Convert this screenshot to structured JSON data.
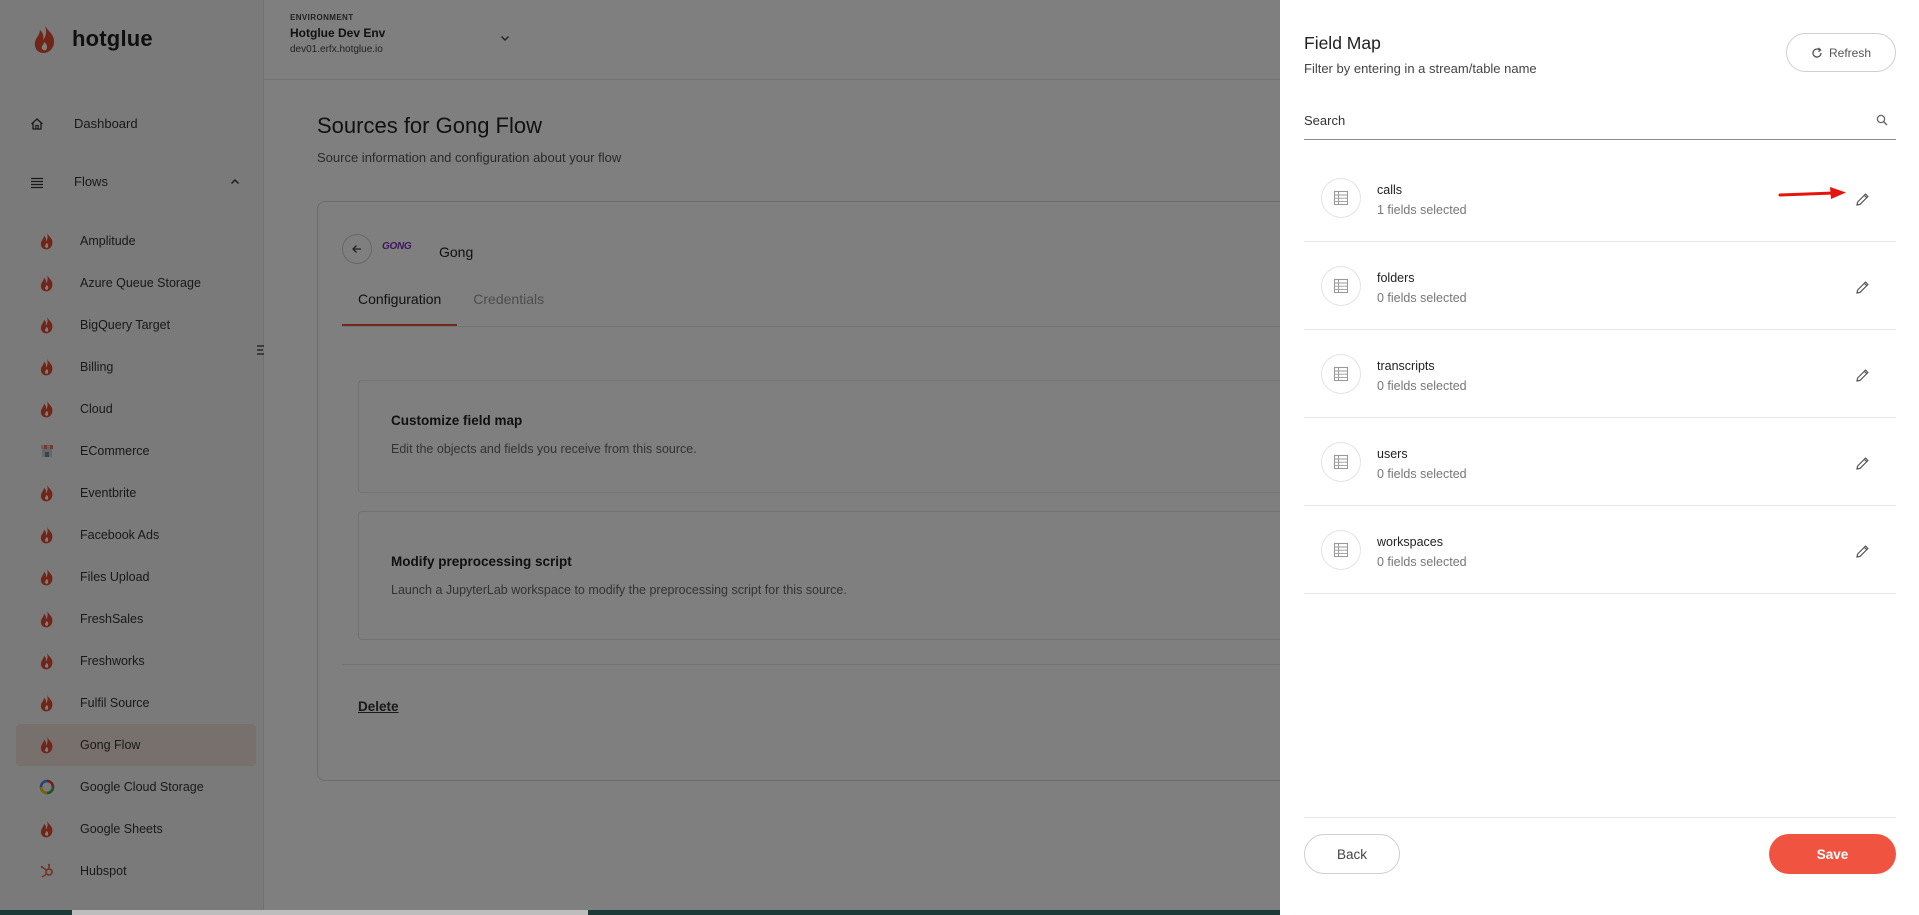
{
  "brand": {
    "name": "hotglue",
    "accent": "#f05440"
  },
  "environment": {
    "caption": "ENVIRONMENT",
    "name": "Hotglue Dev Env",
    "host": "dev01.erfx.hotglue.io"
  },
  "sidebar": {
    "dashboard_label": "Dashboard",
    "flows_label": "Flows",
    "flows": [
      {
        "label": "Amplitude",
        "icon": "hotglue-flame-icon"
      },
      {
        "label": "Azure Queue Storage",
        "icon": "hotglue-flame-icon"
      },
      {
        "label": "BigQuery Target",
        "icon": "hotglue-flame-icon"
      },
      {
        "label": "Billing",
        "icon": "hotglue-flame-icon"
      },
      {
        "label": "Cloud",
        "icon": "hotglue-flame-icon"
      },
      {
        "label": "ECommerce",
        "icon": "store-icon"
      },
      {
        "label": "Eventbrite",
        "icon": "hotglue-flame-icon"
      },
      {
        "label": "Facebook Ads",
        "icon": "hotglue-flame-icon"
      },
      {
        "label": "Files Upload",
        "icon": "hotglue-flame-icon"
      },
      {
        "label": "FreshSales",
        "icon": "hotglue-flame-icon"
      },
      {
        "label": "Freshworks",
        "icon": "hotglue-flame-icon"
      },
      {
        "label": "Fulfil Source",
        "icon": "hotglue-flame-icon"
      },
      {
        "label": "Gong Flow",
        "icon": "hotglue-flame-icon",
        "active": true
      },
      {
        "label": "Google Cloud Storage",
        "icon": "google-cloud-icon"
      },
      {
        "label": "Google Sheets",
        "icon": "hotglue-flame-icon"
      },
      {
        "label": "Hubspot",
        "icon": "hubspot-icon"
      }
    ]
  },
  "main": {
    "title": "Sources for Gong Flow",
    "subtitle": "Source information and configuration about your flow",
    "source_logo_text": "GONG",
    "source_name": "Gong",
    "tabs": [
      {
        "label": "Configuration",
        "active": true
      },
      {
        "label": "Credentials",
        "active": false
      }
    ],
    "sections": [
      {
        "title": "Customize field map",
        "description": "Edit the objects and fields you receive from this source."
      },
      {
        "title": "Modify preprocessing script",
        "description": "Launch a JupyterLab workspace to modify the preprocessing script for this source."
      }
    ],
    "delete_label": "Delete"
  },
  "drawer": {
    "title": "Field Map",
    "subtitle": "Filter by entering in a stream/table name",
    "refresh_label": "Refresh",
    "search_placeholder": "Search",
    "streams": [
      {
        "name": "calls",
        "count": "1 fields selected",
        "annotated": true
      },
      {
        "name": "folders",
        "count": "0 fields selected"
      },
      {
        "name": "transcripts",
        "count": "0 fields selected"
      },
      {
        "name": "users",
        "count": "0 fields selected"
      },
      {
        "name": "workspaces",
        "count": "0 fields selected"
      }
    ],
    "back_label": "Back",
    "save_label": "Save"
  }
}
